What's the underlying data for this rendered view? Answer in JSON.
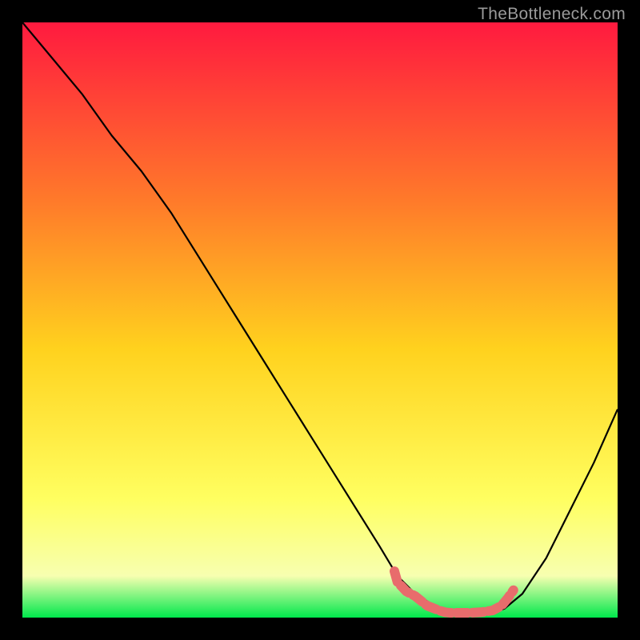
{
  "watermark": "TheBottleneck.com",
  "chart_data": {
    "type": "line",
    "title": "",
    "xlabel": "",
    "ylabel": "",
    "xlim": [
      0,
      100
    ],
    "ylim": [
      0,
      100
    ],
    "background_gradient": {
      "top": "#ff1a3f",
      "mid_upper": "#ff7a2a",
      "mid": "#ffd21e",
      "mid_lower": "#ffff60",
      "mid_lower2": "#f7ffb0",
      "bottom": "#00e84c"
    },
    "series": [
      {
        "name": "bottleneck-curve",
        "x": [
          0,
          5,
          10,
          15,
          20,
          25,
          30,
          35,
          40,
          45,
          50,
          55,
          60,
          63,
          66,
          70,
          74,
          78,
          81,
          84,
          88,
          92,
          96,
          100
        ],
        "values": [
          100,
          94,
          88,
          81,
          75,
          68,
          60,
          52,
          44,
          36,
          28,
          20,
          12,
          7,
          4,
          1.5,
          0.6,
          0.6,
          1.5,
          4,
          10,
          18,
          26,
          35
        ]
      }
    ],
    "highlight": {
      "name": "optimal-range-marker",
      "color": "#e86c6c",
      "x": [
        62.5,
        63.0,
        64.5,
        66.0,
        68.0,
        70.0,
        71.0,
        72.0,
        73.5,
        75.0,
        77.0,
        79.0,
        80.5,
        81.5,
        82.5
      ],
      "values": [
        7.8,
        6.0,
        4.4,
        3.6,
        2.0,
        1.2,
        0.9,
        0.8,
        0.8,
        0.8,
        0.9,
        1.2,
        2.0,
        3.2,
        4.6
      ]
    }
  }
}
